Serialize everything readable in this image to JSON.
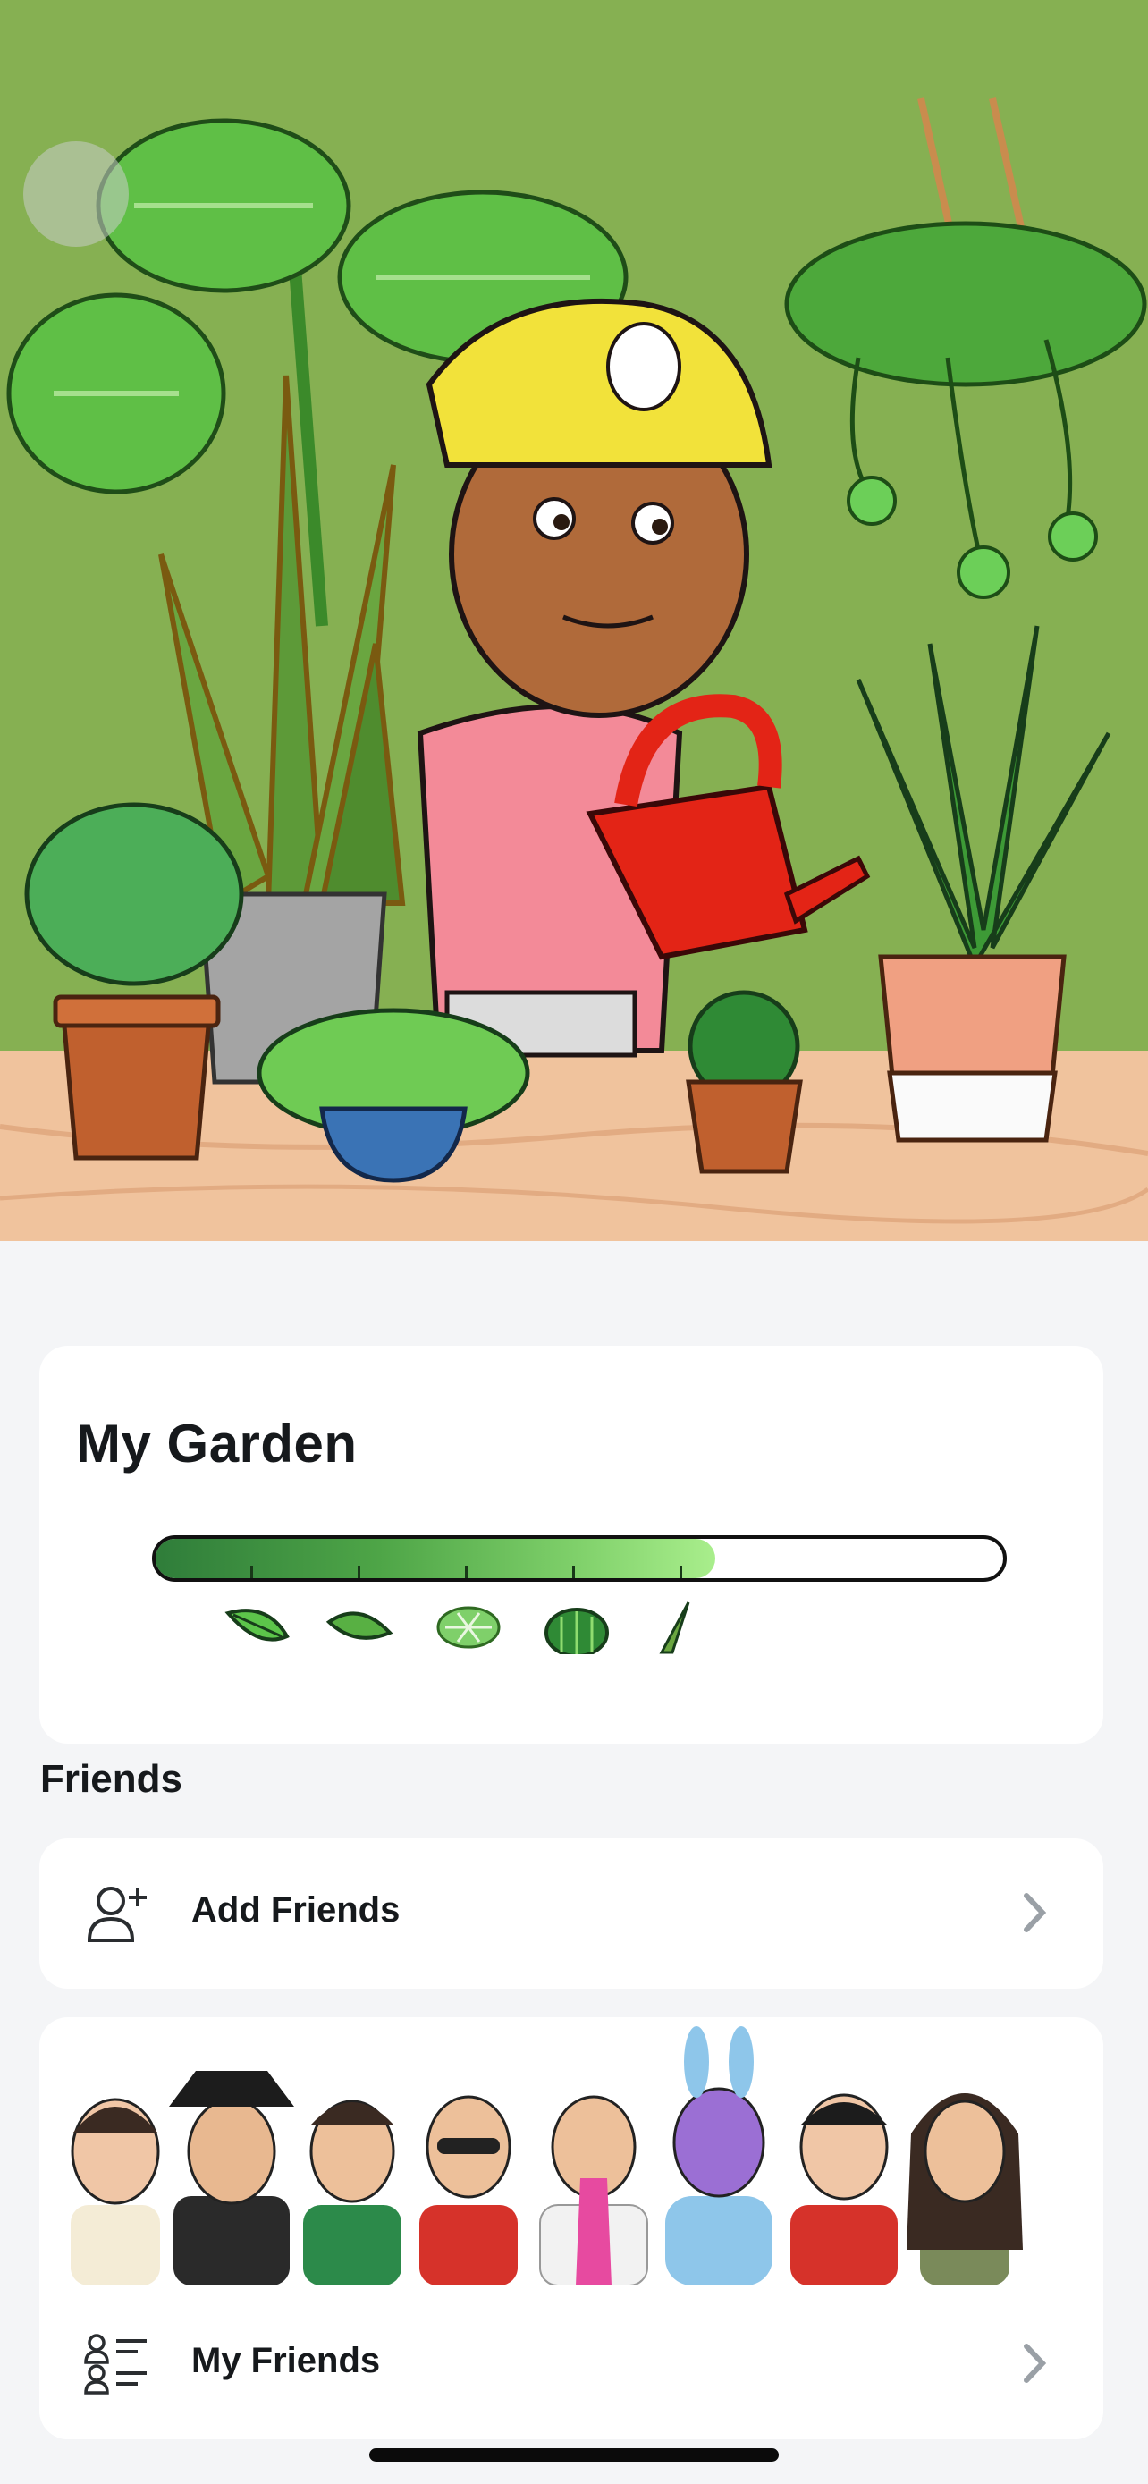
{
  "header": {
    "back_button_icon": "back-icon"
  },
  "hero": {
    "scene": "bitmoji-watering-plants",
    "colors": {
      "wall": "#86b052",
      "table": "#f0c39d"
    }
  },
  "garden": {
    "title": "My Garden",
    "progress_fraction": 0.66,
    "milestone_icons": [
      "leaf-icon",
      "leaf-outline-icon",
      "monstera-icon",
      "cactus-icon",
      "snake-plant-icon"
    ]
  },
  "friends_section": {
    "heading": "Friends",
    "add_friends": {
      "label": "Add Friends",
      "icon": "add-friend-icon"
    },
    "my_friends": {
      "label": "My Friends",
      "icon": "friends-list-icon"
    },
    "avatar_count": 8
  },
  "colors": {
    "accent_green": "#4ea547",
    "background": "#f4f5f7",
    "card": "#ffffff"
  }
}
